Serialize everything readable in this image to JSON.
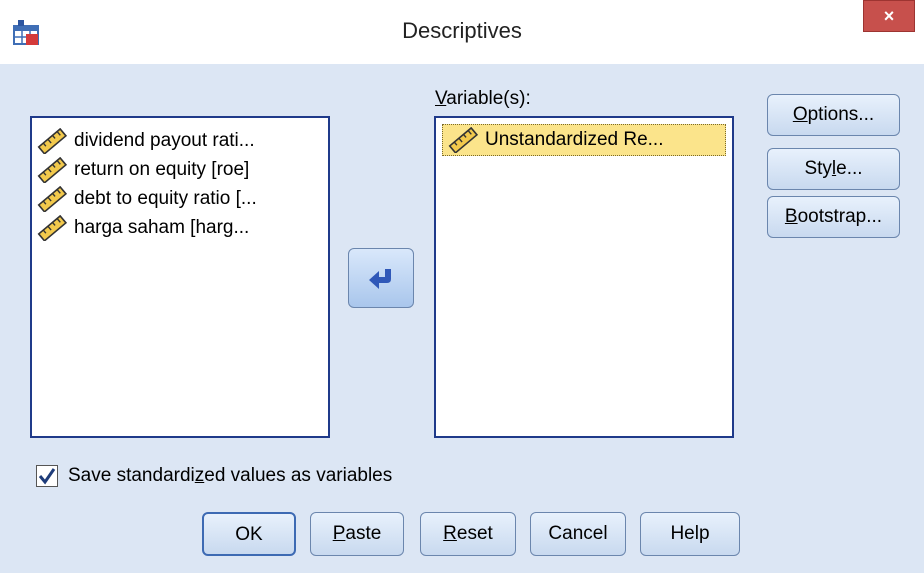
{
  "window": {
    "title": "Descriptives",
    "close_label": "×"
  },
  "source_list": {
    "items": [
      {
        "label": "dividend payout rati..."
      },
      {
        "label": "return on equity [roe]"
      },
      {
        "label": "debt to equity ratio [..."
      },
      {
        "label": "harga saham [harg..."
      }
    ]
  },
  "target": {
    "label_mnemonic": "V",
    "label_rest": "ariable(s):",
    "items": [
      {
        "label": "Unstandardized Re..."
      }
    ]
  },
  "side_buttons": {
    "options": {
      "pre": "",
      "mn": "O",
      "post": "ptions..."
    },
    "style": {
      "pre": "Sty",
      "mn": "l",
      "post": "e..."
    },
    "bootstrap": {
      "pre": "",
      "mn": "B",
      "post": "ootstrap..."
    }
  },
  "checkbox": {
    "checked": true,
    "label_pre": "Save standardi",
    "label_mn": "z",
    "label_post": "ed values as variables"
  },
  "bottom_buttons": {
    "ok": "OK",
    "paste": {
      "mn": "P",
      "post": "aste"
    },
    "reset": {
      "mn": "R",
      "post": "eset"
    },
    "cancel": "Cancel",
    "help": "Help"
  },
  "icons": {
    "app": "spss-table-icon",
    "variable": "ruler-scale-icon",
    "move": "left-arrow-icon"
  },
  "colors": {
    "background": "#dce6f4",
    "list_border": "#1f3a8a",
    "selected_item": "#fbe48b",
    "close_button": "#c7504c"
  }
}
